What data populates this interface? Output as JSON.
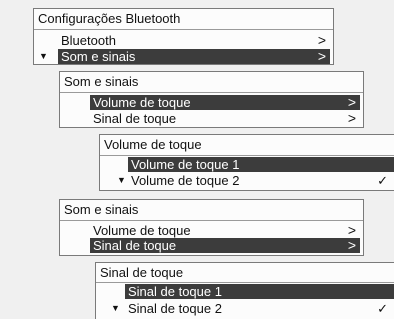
{
  "menu1": {
    "title": "Configurações Bluetooth",
    "items": [
      {
        "label": "Bluetooth",
        "chevron": ">"
      },
      {
        "label": "Som e sinais",
        "chevron": ">"
      }
    ]
  },
  "menu2": {
    "title": "Som e sinais",
    "items": [
      {
        "label": "Volume de toque",
        "chevron": ">"
      },
      {
        "label": "Sinal de toque",
        "chevron": ">"
      }
    ]
  },
  "menu3": {
    "title": "Volume de toque",
    "items": [
      {
        "label": "Volume de toque 1"
      },
      {
        "label": "Volume de toque 2",
        "check": "✓"
      }
    ]
  },
  "menu4": {
    "title": "Som e sinais",
    "items": [
      {
        "label": "Volume de toque",
        "chevron": ">"
      },
      {
        "label": "Sinal de toque",
        "chevron": ">"
      }
    ]
  },
  "menu5": {
    "title": "Sinal de toque",
    "items": [
      {
        "label": "Sinal de toque 1"
      },
      {
        "label": "Sinal de toque 2",
        "check": "✓"
      }
    ]
  },
  "scroll_indicator": "▼"
}
